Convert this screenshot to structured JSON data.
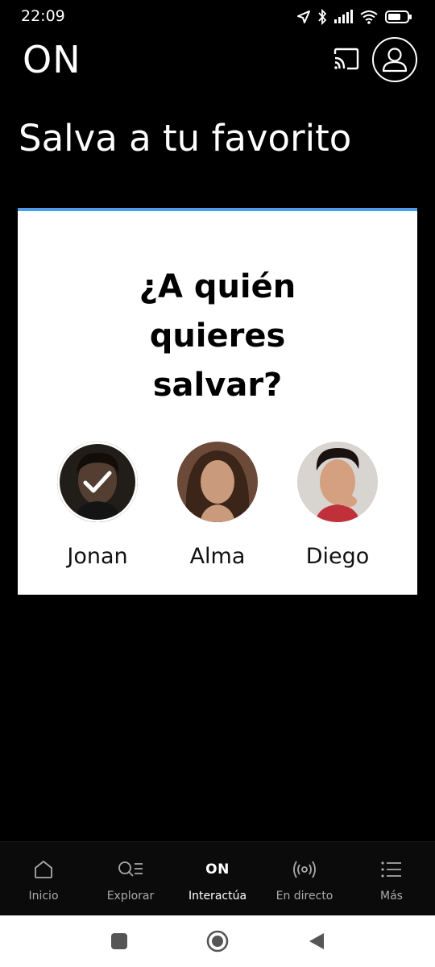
{
  "status_bar": {
    "time": "22:09",
    "icons": [
      "location-icon",
      "bluetooth-icon",
      "signal-icon",
      "wifi-icon",
      "battery-icon"
    ]
  },
  "header": {
    "logo": "ON",
    "cast_icon": "cast-icon",
    "profile_icon": "user-icon"
  },
  "page": {
    "title": "Salva a tu favorito"
  },
  "poll": {
    "question_lines": [
      "¿A quién",
      "quieres",
      "salvar?"
    ],
    "accent_color": "#4a9de8",
    "candidates": [
      {
        "name": "Jonan",
        "selected": true
      },
      {
        "name": "Alma",
        "selected": false
      },
      {
        "name": "Diego",
        "selected": false
      }
    ]
  },
  "bottom_nav": {
    "items": [
      {
        "label": "Inicio",
        "icon": "home-icon",
        "active": false
      },
      {
        "label": "Explorar",
        "icon": "search-list-icon",
        "active": false
      },
      {
        "label": "Interactúa",
        "icon": "on-logo-icon",
        "icon_text": "ON",
        "active": true
      },
      {
        "label": "En directo",
        "icon": "live-broadcast-icon",
        "active": false
      },
      {
        "label": "Más",
        "icon": "menu-list-icon",
        "active": false
      }
    ]
  },
  "system_nav": {
    "buttons": [
      "recents-icon",
      "home-circle-icon",
      "back-icon"
    ]
  }
}
